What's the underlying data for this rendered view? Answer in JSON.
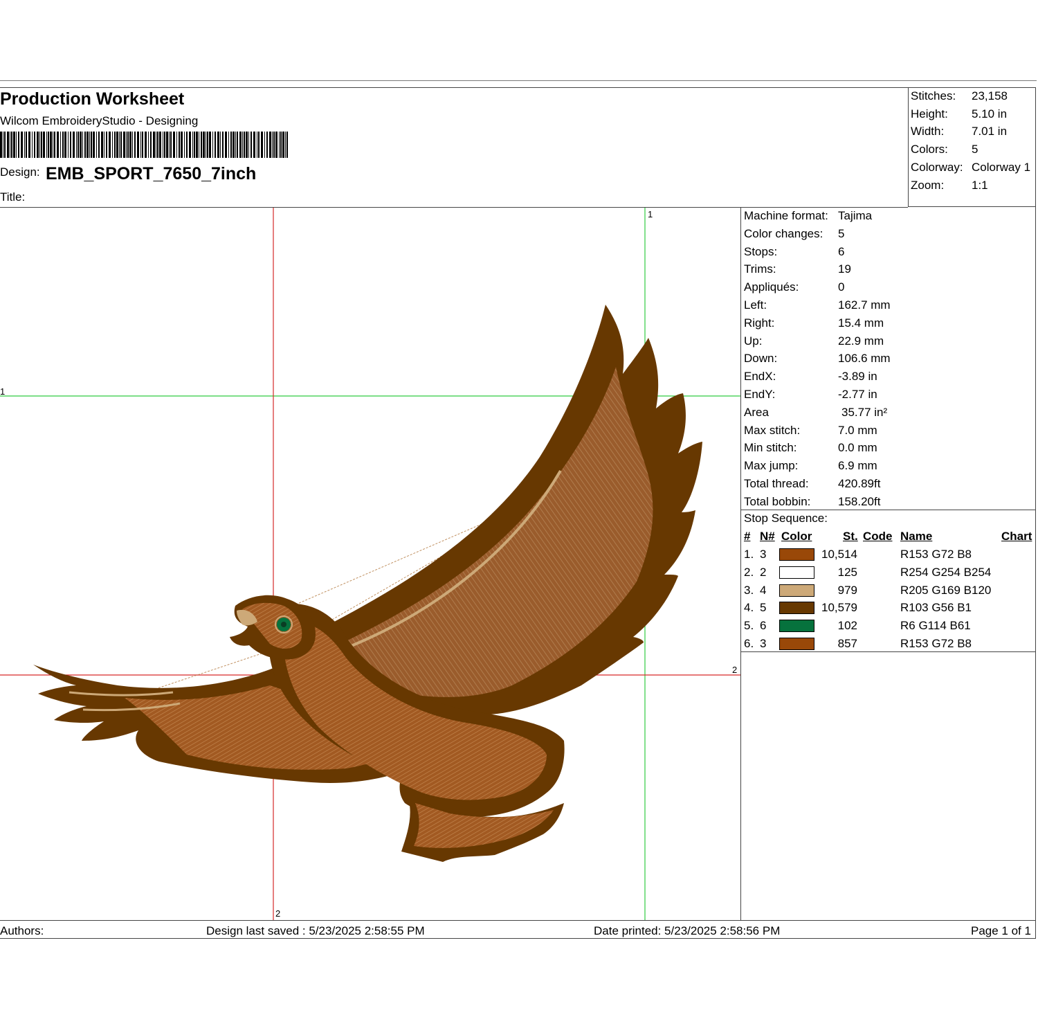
{
  "header": {
    "title": "Production Worksheet",
    "subtitle": "Wilcom EmbroideryStudio - Designing",
    "design_label": "Design:",
    "design_name": "EMB_SPORT_7650_7inch",
    "title_label": "Title:"
  },
  "summary": [
    {
      "label": "Stitches:",
      "value": "23,158"
    },
    {
      "label": "Height:",
      "value": "5.10 in"
    },
    {
      "label": "Width:",
      "value": "7.01 in"
    },
    {
      "label": "Colors:",
      "value": "5"
    },
    {
      "label": "Colorway:",
      "value": "Colorway 1"
    },
    {
      "label": "Zoom:",
      "value": "1:1"
    }
  ],
  "machine_info": [
    {
      "label": "Machine format:",
      "value": "Tajima"
    },
    {
      "label": "Color changes:",
      "value": "5"
    },
    {
      "label": "Stops:",
      "value": "6"
    },
    {
      "label": "Trims:",
      "value": "19"
    },
    {
      "label": "Appliqués:",
      "value": "0"
    },
    {
      "label": "Left:",
      "value": "162.7 mm"
    },
    {
      "label": "Right:",
      "value": "15.4 mm"
    },
    {
      "label": "Up:",
      "value": "22.9 mm"
    },
    {
      "label": "Down:",
      "value": "106.6 mm"
    },
    {
      "label": "EndX:",
      "value": "-3.89 in"
    },
    {
      "label": "EndY:",
      "value": "-2.77 in"
    },
    {
      "label": "Area",
      "value": "35.77 in²"
    },
    {
      "label": "Max stitch:",
      "value": "7.0 mm"
    },
    {
      "label": "Min stitch:",
      "value": "0.0 mm"
    },
    {
      "label": "Max jump:",
      "value": "6.9 mm"
    },
    {
      "label": "Total thread:",
      "value": "420.89ft"
    },
    {
      "label": "Total bobbin:",
      "value": "158.20ft"
    }
  ],
  "stop_sequence": {
    "title": "Stop Sequence:",
    "headers": {
      "num": "#",
      "needle": "N#",
      "color": "Color",
      "stitches": "St.",
      "code": "Code",
      "name": "Name",
      "chart": "Chart"
    },
    "rows": [
      {
        "num": "1.",
        "needle": "3",
        "color": "#994808",
        "stitches": "10,514",
        "name": "R153 G72 B8"
      },
      {
        "num": "2.",
        "needle": "2",
        "color": "#FEFEFE",
        "stitches": "125",
        "name": "R254 G254 B254"
      },
      {
        "num": "3.",
        "needle": "4",
        "color": "#CDA978",
        "stitches": "979",
        "name": "R205 G169 B120"
      },
      {
        "num": "4.",
        "needle": "5",
        "color": "#673801",
        "stitches": "10,579",
        "name": "R103 G56 B1"
      },
      {
        "num": "5.",
        "needle": "6",
        "color": "#06723D",
        "stitches": "102",
        "name": "R6 G114 B61"
      },
      {
        "num": "6.",
        "needle": "3",
        "color": "#994808",
        "stitches": "857",
        "name": "R153 G72 B8"
      }
    ]
  },
  "guides": {
    "green_top": "1",
    "green_left": "1",
    "red_right": "2",
    "red_bottom": "2"
  },
  "footer": {
    "authors": "Authors:",
    "last_saved": "Design last saved : 5/23/2025 2:58:55 PM",
    "printed": "Date printed: 5/23/2025 2:58:56 PM",
    "page": "Page 1 of 1"
  },
  "colors": {
    "dark_brown": "#673801",
    "rust": "#994808",
    "tan": "#CDA978",
    "green": "#06723D"
  }
}
